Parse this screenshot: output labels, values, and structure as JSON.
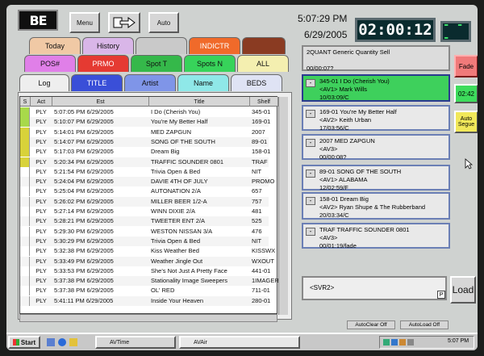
{
  "app": {
    "logo": "BE"
  },
  "toolbar": {
    "menu_label": "Menu",
    "auto_label": "Auto"
  },
  "clock": {
    "time": "5:07:29 PM",
    "date": "6/29/2005",
    "countdown": "02:00:12",
    "secondary": "- - -"
  },
  "tabs_row1": [
    {
      "label": "Today",
      "color": "#f0c9a5"
    },
    {
      "label": "History",
      "color": "#d9b6e8"
    },
    {
      "label": "",
      "color": "#c9c9c9"
    },
    {
      "label": "INDICTR",
      "color": "#f06a2a"
    },
    {
      "label": "",
      "color": "#8a3b22"
    }
  ],
  "tabs_row2": [
    {
      "label": "POS#",
      "color": "#e07fe8"
    },
    {
      "label": "PRMO",
      "color": "#e53a32"
    },
    {
      "label": "Spot T",
      "color": "#35b84a"
    },
    {
      "label": "Spots N",
      "color": "#37d35a"
    },
    {
      "label": "ALL",
      "color": "#f4efb0"
    }
  ],
  "tabs_row3": [
    {
      "label": "Log",
      "color": "#eeeeee"
    },
    {
      "label": "TITLE",
      "color": "#3a4fd8"
    },
    {
      "label": "Artist",
      "color": "#7f95e8"
    },
    {
      "label": "Name",
      "color": "#8fe8e8"
    },
    {
      "label": "BEDS",
      "color": "#dfe3f4"
    }
  ],
  "grid": {
    "headers": [
      "S",
      "Act",
      "Est",
      "Title",
      "Shelf"
    ],
    "rows": [
      {
        "s": "#a8d94a",
        "act": "PLY",
        "est": "5:07:05 PM 6/29/2005",
        "title": "I Do (Cherish You)",
        "shelf": "345-01"
      },
      {
        "s": "#a8d94a",
        "act": "PLY",
        "est": "5:10:07 PM 6/29/2005",
        "title": "You're My Better Half",
        "shelf": "169-01"
      },
      {
        "s": "#d8d23a",
        "act": "PLY",
        "est": "5:14:01 PM 6/29/2005",
        "title": "MED ZAPGUN",
        "shelf": "2007"
      },
      {
        "s": "#d8d23a",
        "act": "PLY",
        "est": "5:14:07 PM 6/29/2005",
        "title": "SONG OF THE SOUTH",
        "shelf": "89-01"
      },
      {
        "s": "#d8d23a",
        "act": "PLY",
        "est": "5:17:03 PM 6/29/2005",
        "title": "Dream Big",
        "shelf": "158-01"
      },
      {
        "s": "#d8d23a",
        "act": "PLY",
        "est": "5:20:34 PM 6/29/2005",
        "title": "TRAFFIC SOUNDER 0801",
        "shelf": "TRAF"
      },
      {
        "s": "",
        "act": "PLY",
        "est": "5:21:54 PM 6/29/2005",
        "title": "Trivia Open & Bed",
        "shelf": "NIT"
      },
      {
        "s": "",
        "act": "PLY",
        "est": "5:24:04 PM 6/29/2005",
        "title": "DAVIE 4TH OF JULY",
        "shelf": "PROMO"
      },
      {
        "s": "",
        "act": "PLY",
        "est": "5:25:04 PM 6/29/2005",
        "title": "AUTONATION 2/A",
        "shelf": "657"
      },
      {
        "s": "",
        "act": "PLY",
        "est": "5:26:02 PM 6/29/2005",
        "title": "MILLER BEER 1/2-A",
        "shelf": "757"
      },
      {
        "s": "",
        "act": "PLY",
        "est": "5:27:14 PM 6/29/2005",
        "title": "WINN DIXIE 2/A",
        "shelf": "481"
      },
      {
        "s": "",
        "act": "PLY",
        "est": "5:28:21 PM 6/29/2005",
        "title": "TWEETER ENT 2/A",
        "shelf": "525"
      },
      {
        "s": "",
        "act": "PLY",
        "est": "5:29:30 PM 6/29/2005",
        "title": "WESTON NISSAN 3/A",
        "shelf": "476"
      },
      {
        "s": "",
        "act": "PLY",
        "est": "5:30:29 PM 6/29/2005",
        "title": "Trivia Open & Bed",
        "shelf": "NIT"
      },
      {
        "s": "",
        "act": "PLY",
        "est": "5:32:38 PM 6/29/2005",
        "title": "Kiss Weather Bed",
        "shelf": "KISSWX"
      },
      {
        "s": "",
        "act": "PLY",
        "est": "5:33:49 PM 6/29/2005",
        "title": "Weather Jingle Out",
        "shelf": "WXOUT"
      },
      {
        "s": "",
        "act": "PLY",
        "est": "5:33:53 PM 6/29/2005",
        "title": "She's Not Just A Pretty Face",
        "shelf": "441-01"
      },
      {
        "s": "",
        "act": "PLY",
        "est": "5:37:38 PM 6/29/2005",
        "title": "Stationality Image Sweepers",
        "shelf": "1IMAGER"
      },
      {
        "s": "",
        "act": "PLY",
        "est": "5:37:38 PM 6/29/2005",
        "title": "OL' RED",
        "shelf": "711-01"
      },
      {
        "s": "",
        "act": "PLY",
        "est": "5:41:11 PM 6/29/2005",
        "title": "Inside Your Heaven",
        "shelf": "280-01"
      }
    ]
  },
  "queue": [
    {
      "lines": "2QUANT Generic Quantity Sell\n\n00/00:07?",
      "selected": false,
      "top": true
    },
    {
      "lines": "345-01 I Do (Cherish You)\n<AV1> Mark Wills\n10/03:09/C",
      "selected": true
    },
    {
      "lines": "169-01 You're My Better Half\n<AV2> Keith Urban\n17/03:56/C",
      "selected": false
    },
    {
      "lines": "2007 MED ZAPGUN\n<AV3>\n00/00:08?",
      "selected": false
    },
    {
      "lines": "89-01 SONG OF THE SOUTH\n<AV1> ALABAMA\n12/02:59/F",
      "selected": false
    },
    {
      "lines": "158-01 Dream Big\n<AV2> Ryan Shupe & The Rubberband\n20/03:34/C",
      "selected": false
    },
    {
      "lines": "TRAF TRAFFIC SOUNDER 0801\n<AV3>\n00/01:19/fade",
      "selected": false
    }
  ],
  "side": {
    "fade": "Fade",
    "timer": "02:42",
    "auto_segue": "Auto Segue",
    "load": "Load"
  },
  "svr": {
    "label": "<SVR2>",
    "p": "P"
  },
  "status": {
    "autoclear": "AutoClear Off",
    "autoload": "AutoLoad Off"
  },
  "taskbar": {
    "start": "Start",
    "task1": "AVTime",
    "task2": "AVAir",
    "clock": "5:07 PM"
  }
}
